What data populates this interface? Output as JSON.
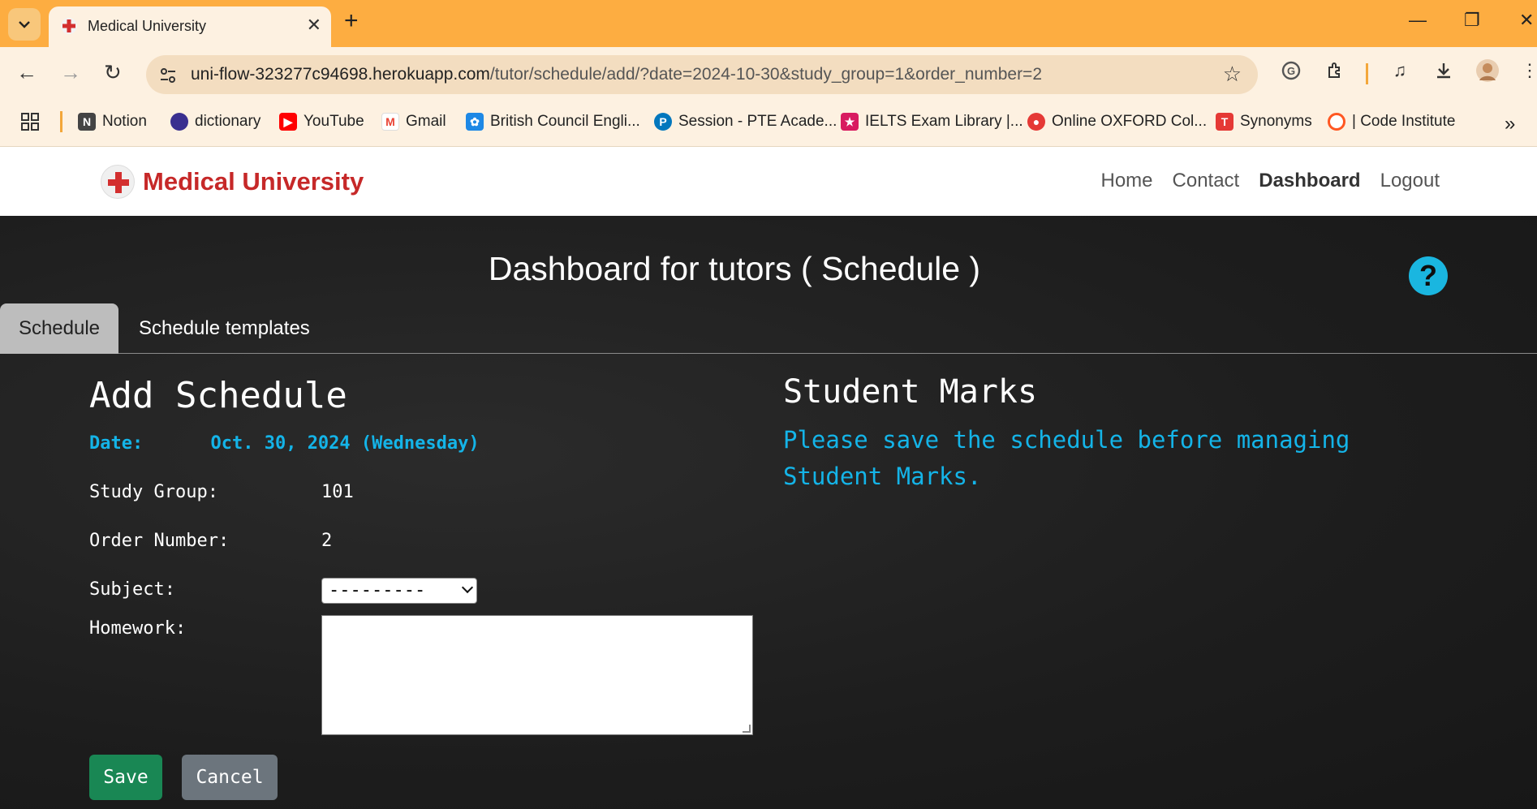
{
  "browser": {
    "tab_title": "Medical University",
    "url_host": "uni-flow-323277c94698.herokuapp.com",
    "url_path": "/tutor/schedule/add/?date=2024-10-30&study_group=1&order_number=2",
    "bookmarks": [
      {
        "label": "Notion",
        "icon": "notion-icon",
        "color": "#444444"
      },
      {
        "label": "dictionary",
        "icon": "dictionary-icon",
        "color": "#3a2f8f"
      },
      {
        "label": "YouTube",
        "icon": "youtube-icon",
        "color": "#ff0000"
      },
      {
        "label": "Gmail",
        "icon": "gmail-icon",
        "color": "#ea4335"
      },
      {
        "label": "British Council Engli...",
        "icon": "british-council-icon",
        "color": "#1e88e5"
      },
      {
        "label": "Session - PTE Acade...",
        "icon": "pte-icon",
        "color": "#0277bd"
      },
      {
        "label": "IELTS Exam Library |...",
        "icon": "ielts-icon",
        "color": "#d81b60"
      },
      {
        "label": "Online OXFORD Col...",
        "icon": "oxford-icon",
        "color": "#e53935"
      },
      {
        "label": "Synonyms",
        "icon": "synonyms-icon",
        "color": "#e53935"
      },
      {
        "label": "| Code Institute",
        "icon": "code-institute-icon",
        "color": "#ff5722"
      }
    ]
  },
  "site": {
    "brand": "Medical University",
    "nav": [
      "Home",
      "Contact",
      "Dashboard",
      "Logout"
    ],
    "active_nav": "Dashboard"
  },
  "page": {
    "title": "Dashboard for tutors ( Schedule )",
    "tabs": [
      "Schedule",
      "Schedule templates"
    ],
    "active_tab": "Schedule"
  },
  "form": {
    "heading": "Add Schedule",
    "date_label": "Date:",
    "date_value": "Oct. 30, 2024 (Wednesday)",
    "study_group_label": "Study Group:",
    "study_group_value": "101",
    "order_number_label": "Order Number:",
    "order_number_value": "2",
    "subject_label": "Subject:",
    "subject_value": "---------",
    "homework_label": "Homework:",
    "homework_value": "",
    "save_label": "Save",
    "cancel_label": "Cancel"
  },
  "marks": {
    "heading": "Student Marks",
    "notice": "Please save the schedule before managing Student Marks."
  },
  "colors": {
    "chrome_accent": "#fdad41",
    "brand_red": "#c62828",
    "info_cyan": "#14b4e8",
    "save_green": "#198754",
    "cancel_gray": "#6c757d"
  }
}
